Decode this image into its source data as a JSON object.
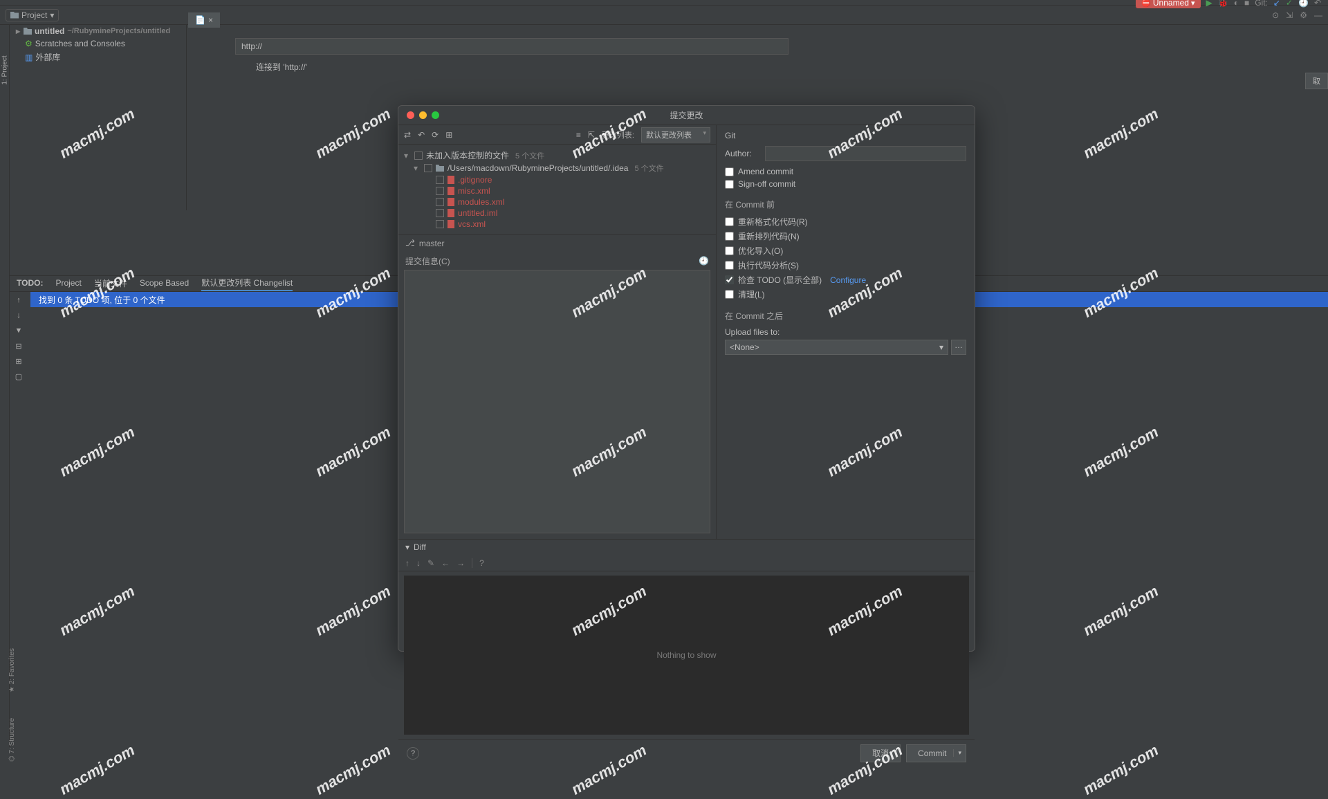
{
  "menubar": {
    "config_name": "Unnamed",
    "git_label": "Git:"
  },
  "toolbar": {
    "project_label": "Project"
  },
  "left_edge": {
    "project": "1: Project"
  },
  "project_tree": {
    "root": "untitled",
    "root_path": "~/RubymineProjects/untitled",
    "scratches": "Scratches and Consoles",
    "external": "外部库"
  },
  "url": {
    "value": "http://",
    "status": "连接到 'http://'"
  },
  "cancel_right": "取",
  "todo": {
    "label": "TODO:",
    "tabs": {
      "project": "Project",
      "current": "当前文件",
      "scope": "Scope Based",
      "changelist": "默认更改列表 Changelist"
    },
    "row": "找到 0 条 TODO 项, 位于 0 个文件"
  },
  "bottom_tools": {
    "favorites": "★ 2: Favorites",
    "structure": "⌬ 7: Structure"
  },
  "dialog": {
    "title": "提交更改",
    "changelist_label": "更改列表:",
    "changelist_value": "默认更改列表",
    "tree": {
      "unversioned": {
        "label": "未加入版本控制的文件",
        "count": "5 个文件"
      },
      "path_row": {
        "label": "/Users/macdown/RubymineProjects/untitled/.idea",
        "count": "5 个文件"
      },
      "files": [
        ".gitignore",
        "misc.xml",
        "modules.xml",
        "untitled.iml",
        "vcs.xml"
      ]
    },
    "branch": "master",
    "commit_msg_label": "提交信息(C)"
  },
  "git_panel": {
    "header": "Git",
    "author_label": "Author:",
    "author_value": "",
    "amend": "Amend commit",
    "signoff": "Sign-off commit",
    "before_commit": "在 Commit 前",
    "reformat": "重新格式化代码(R)",
    "rearrange": "重新排列代码(N)",
    "optimize": "优化导入(O)",
    "analysis": "执行代码分析(S)",
    "check_todo": "检查 TODO (显示全部)",
    "configure": "Configure",
    "cleanup": "清理(L)",
    "after_commit": "在 Commit 之后",
    "upload_label": "Upload files to:",
    "upload_value": "<None>"
  },
  "diff": {
    "label": "Diff",
    "nothing": "Nothing to show",
    "help": "?"
  },
  "footer": {
    "cancel": "取消",
    "commit": "Commit"
  },
  "watermark": "macmj.com"
}
